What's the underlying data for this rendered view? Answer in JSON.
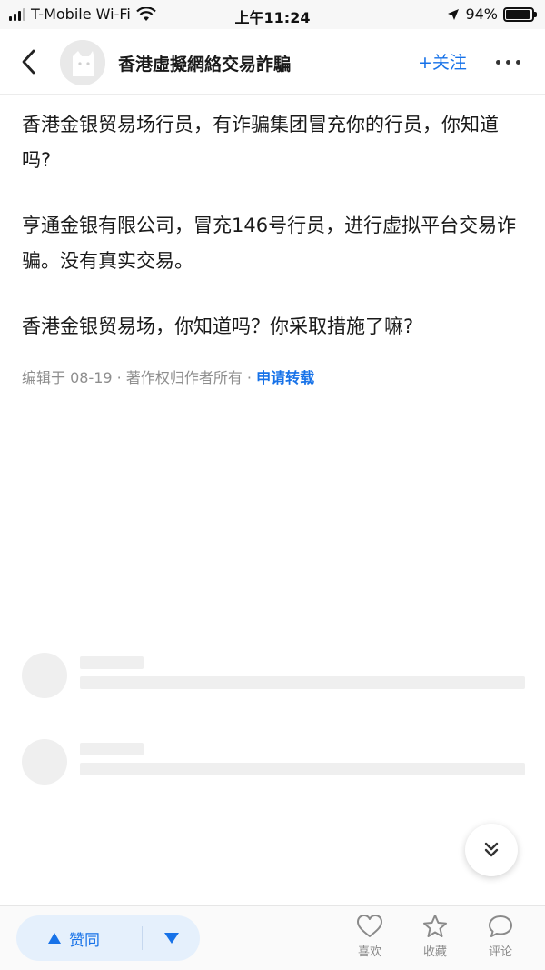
{
  "status_bar": {
    "carrier": "T-Mobile Wi-Fi",
    "time": "上午11:24",
    "battery_text": "94%",
    "battery_level": 0.94
  },
  "header": {
    "title": "香港虛擬網絡交易詐騙",
    "follow_label": "+关注"
  },
  "content": {
    "paragraphs": [
      "香港金银贸易场行员，有诈骗集团冒充你的行员，你知道吗?",
      "亨通金银有限公司，冒充146号行员，进行虚拟平台交易诈骗。没有真实交易。",
      "香港金银贸易场，你知道吗？你采取措施了嘛?"
    ],
    "meta_text": "编辑于 08-19 · 著作权归作者所有 · ",
    "meta_link": "申请转载"
  },
  "bottom_bar": {
    "upvote_label": "赞同",
    "like_label": "喜欢",
    "collect_label": "收藏",
    "comment_label": "评论"
  },
  "icons": {
    "back": "chevron-left-icon",
    "more": "more-icon",
    "scroll": "double-chevron-down-icon",
    "upvote": "triangle-up-icon",
    "downvote": "triangle-down-icon",
    "like": "heart-icon",
    "collect": "star-icon",
    "comment": "chat-bubble-icon"
  },
  "colors": {
    "accent": "#1772e8",
    "vote_bg": "#e5f0fc",
    "skeleton": "#efefef"
  }
}
